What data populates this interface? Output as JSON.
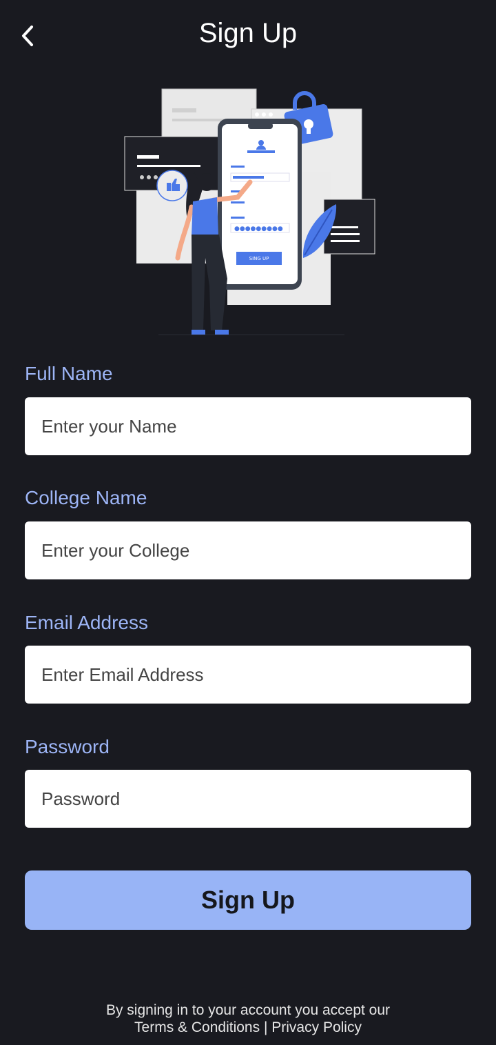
{
  "header": {
    "title": "Sign Up",
    "back_icon": "chevron-left-icon"
  },
  "illustration": {
    "button_text": "SING UP"
  },
  "form": {
    "full_name": {
      "label": "Full Name",
      "placeholder": "Enter your Name"
    },
    "college_name": {
      "label": "College Name",
      "placeholder": "Enter your College"
    },
    "email": {
      "label": "Email Address",
      "placeholder": "Enter Email Address"
    },
    "password": {
      "label": "Password",
      "placeholder": "Password"
    },
    "submit_label": "Sign Up"
  },
  "footer": {
    "line1": "By signing in to your account you accept our",
    "terms": "Terms & Conditions",
    "separator": "|",
    "privacy": "Privacy Policy"
  },
  "colors": {
    "background": "#191a20",
    "label": "#9db5f6",
    "button": "#98b4f6",
    "accent_blue": "#4a78e8"
  }
}
